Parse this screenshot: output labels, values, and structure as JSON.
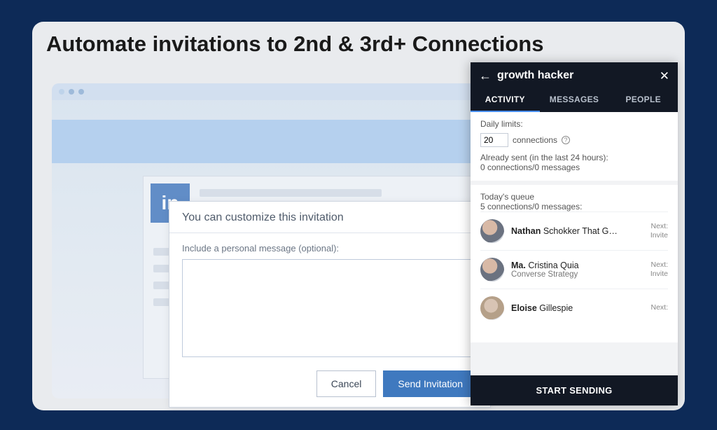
{
  "heading": "Automate invitations to 2nd & 3rd+ Connections",
  "linkedin_logo_text": "in",
  "modal": {
    "title": "You can customize this invitation",
    "field_label": "Include a personal message (optional):",
    "cancel": "Cancel",
    "send": "Send Invitation"
  },
  "panel": {
    "title": "growth hacker",
    "tabs": {
      "activity": "ACTIVITY",
      "messages": "MESSAGES",
      "people": "PEOPLE"
    },
    "limits_label": "Daily limits:",
    "limits_value": "20",
    "limits_unit": "connections",
    "sent_label": "Already sent (in the last 24 hours):",
    "sent_value": "0 connections/0 messages",
    "queue_label": "Today's queue",
    "queue_value": "5 connections/0 messages:",
    "queue": [
      {
        "bold": "Nathan",
        "rest": " Schokker That G…",
        "sub": "",
        "next": "Next:",
        "action": "Invite"
      },
      {
        "bold": "Ma.",
        "rest": " Cristina Quia",
        "sub": "Converse Strategy",
        "next": "Next:",
        "action": "Invite"
      },
      {
        "bold": "Eloise",
        "rest": " Gillespie",
        "sub": "",
        "next": "Next:",
        "action": ""
      }
    ],
    "start": "START SENDING"
  }
}
